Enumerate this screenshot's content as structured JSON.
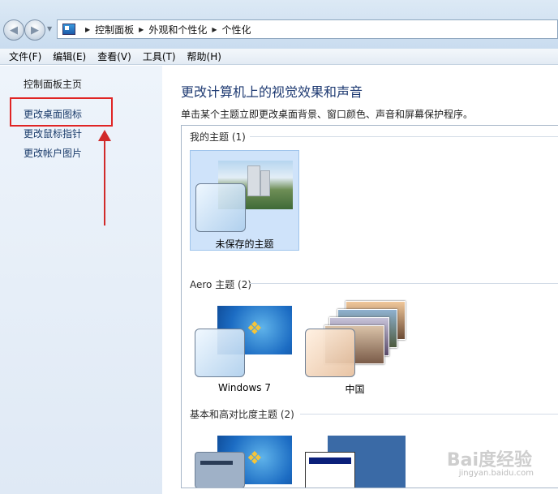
{
  "address": {
    "crumbs": [
      "控制面板",
      "外观和个性化",
      "个性化"
    ]
  },
  "menu": [
    "文件(F)",
    "编辑(E)",
    "查看(V)",
    "工具(T)",
    "帮助(H)"
  ],
  "sidebar": {
    "home": "控制面板主页",
    "items": [
      "更改桌面图标",
      "更改鼠标指针",
      "更改帐户图片"
    ]
  },
  "main": {
    "title": "更改计算机上的视觉效果和声音",
    "description": "单击某个主题立即更改桌面背景、窗口颜色、声音和屏幕保护程序。",
    "groups": {
      "my": {
        "header": "我的主题 (1)",
        "themes": [
          "未保存的主题"
        ]
      },
      "aero": {
        "header": "Aero 主题 (2)",
        "themes": [
          "Windows 7",
          "中国"
        ]
      },
      "basic": {
        "header": "基本和高对比度主题 (2)"
      }
    }
  },
  "watermark": {
    "text": "Bai度经验",
    "sub": "jingyan.baidu.com"
  },
  "colors": {
    "highlight": "#e02424",
    "title_blue": "#1e3a72",
    "selected_bg": "#cfe3fa"
  }
}
